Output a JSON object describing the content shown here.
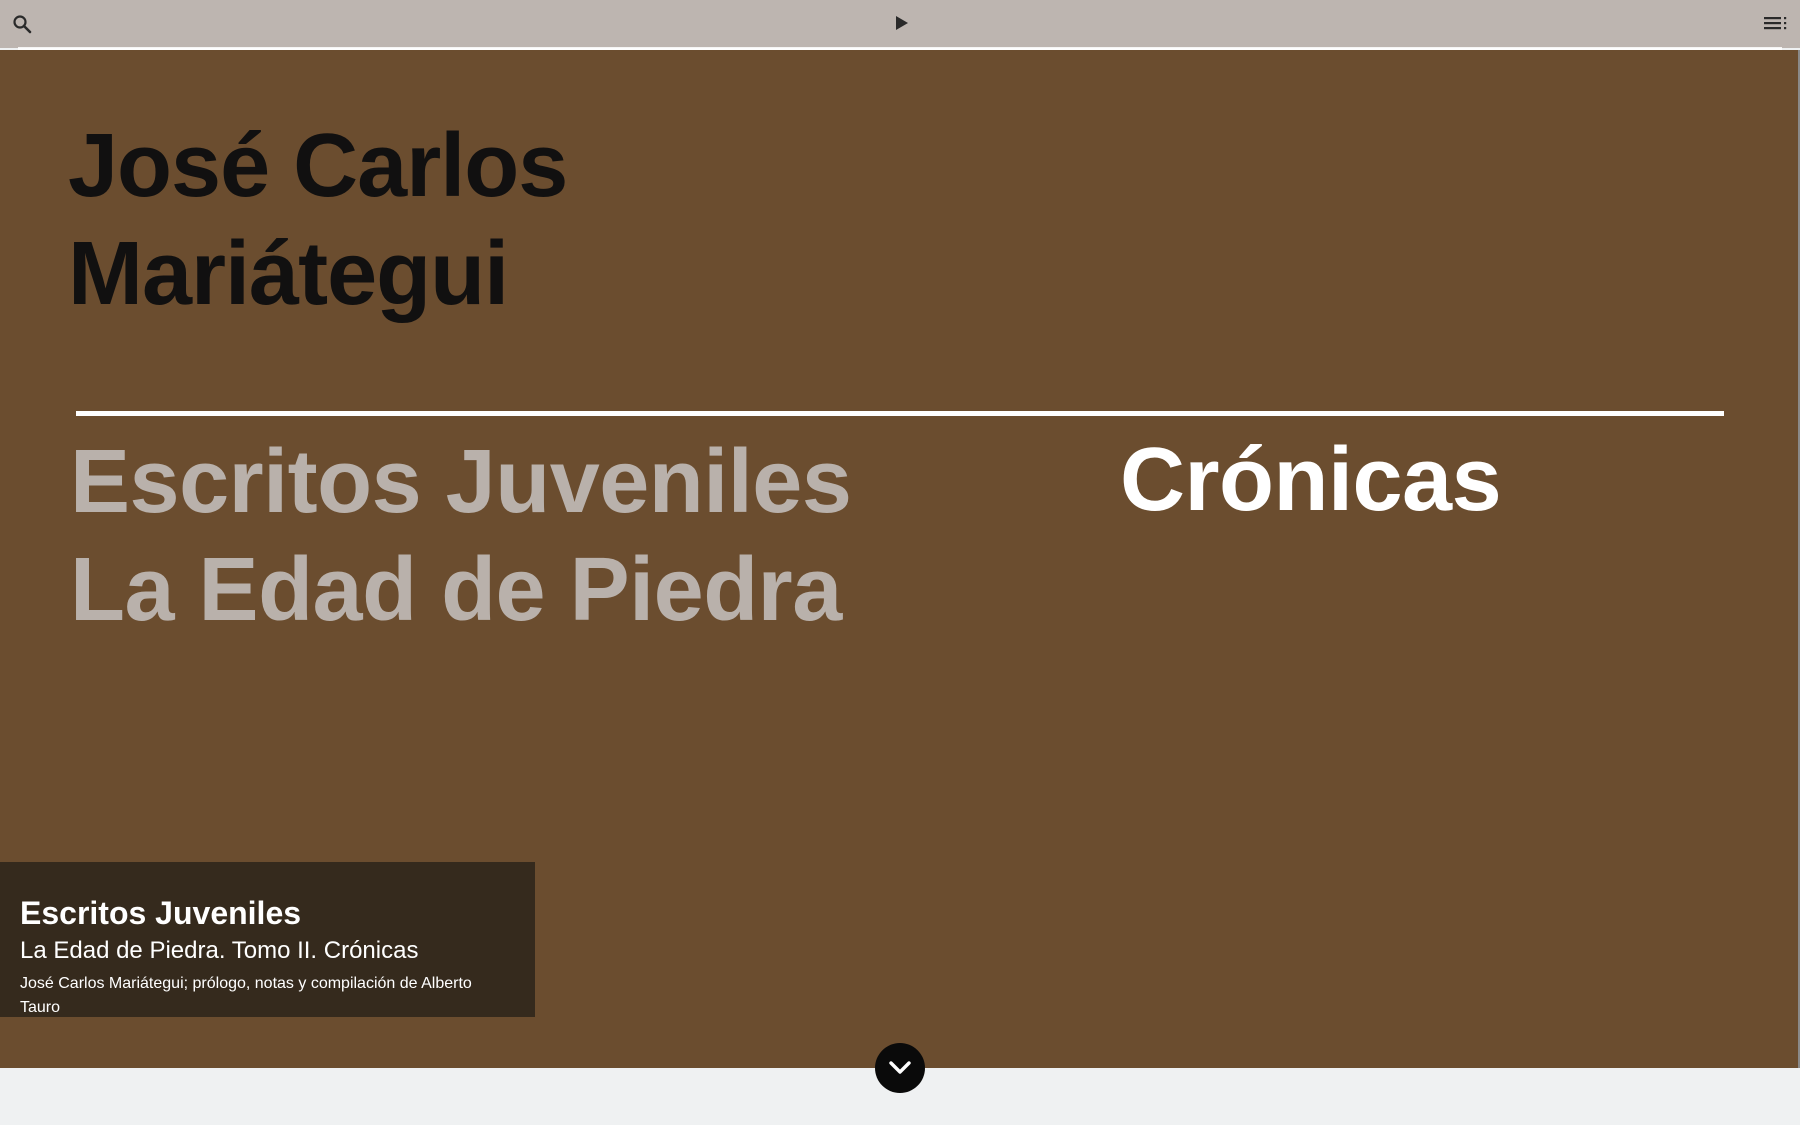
{
  "toolbar": {
    "search_icon": "search-icon",
    "play_icon": "play-icon",
    "menu_icon": "menu-list-icon",
    "background": "#bdb5b0"
  },
  "cover": {
    "background": "#6b4d2f",
    "author_line1": "José Carlos",
    "author_line2": "Mariátegui",
    "series_line1": "Escritos Juveniles",
    "series_line2": "La Edad de Piedra",
    "volume": "Crónicas",
    "author_color": "#111010",
    "series_color": "#b9b1ab",
    "volume_color": "#ffffff"
  },
  "caption": {
    "title": "Escritos Juveniles",
    "subtitle": "La Edad de Piedra. Tomo II. Crónicas",
    "credits": "José Carlos Mariátegui; prólogo, notas y compilación de Alberto Tauro"
  },
  "scroll_button": {
    "icon": "chevron-down-icon"
  }
}
